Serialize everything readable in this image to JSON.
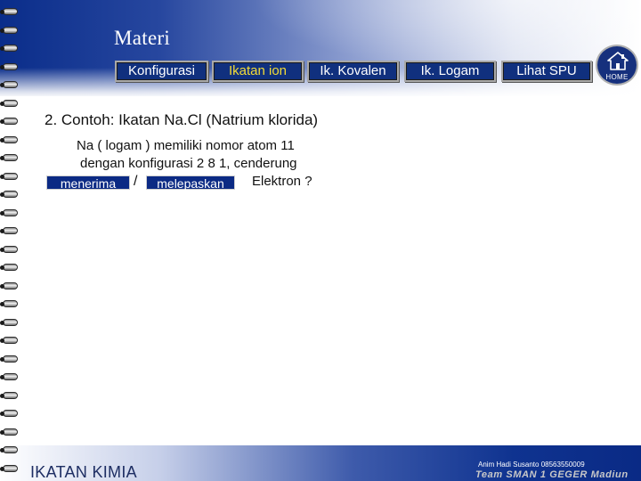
{
  "header": {
    "title": "Materi",
    "nav": [
      {
        "label": "Konfigurasi",
        "active": false
      },
      {
        "label": "Ikatan ion",
        "active": true
      },
      {
        "label": "Ik. Kovalen",
        "active": false
      },
      {
        "label": "Ik.  Logam",
        "active": false
      },
      {
        "label": "Lihat SPU",
        "active": false
      }
    ],
    "home": {
      "label": "HOME",
      "icon": "house-icon"
    }
  },
  "content": {
    "heading": "2. Contoh: Ikatan Na.Cl (Natrium klorida)",
    "line1": "Na ( logam ) memiliki nomor atom  11",
    "line2": "dengan konfigurasi  2 8 1, cenderung",
    "choices": [
      "menerima",
      "melepaskan"
    ],
    "separator": "/",
    "trailing": "Elektron ?"
  },
  "footer": {
    "left_text": "IKATAN KIMIA",
    "credit": "Anim Hadi Susanto 08563550009",
    "team": "Team SMAN 1 GEGER Madiun"
  },
  "colors": {
    "accent": "#0b2a84",
    "active_nav_text": "#f3dc36",
    "banner_dark": "#0a2d8a"
  }
}
